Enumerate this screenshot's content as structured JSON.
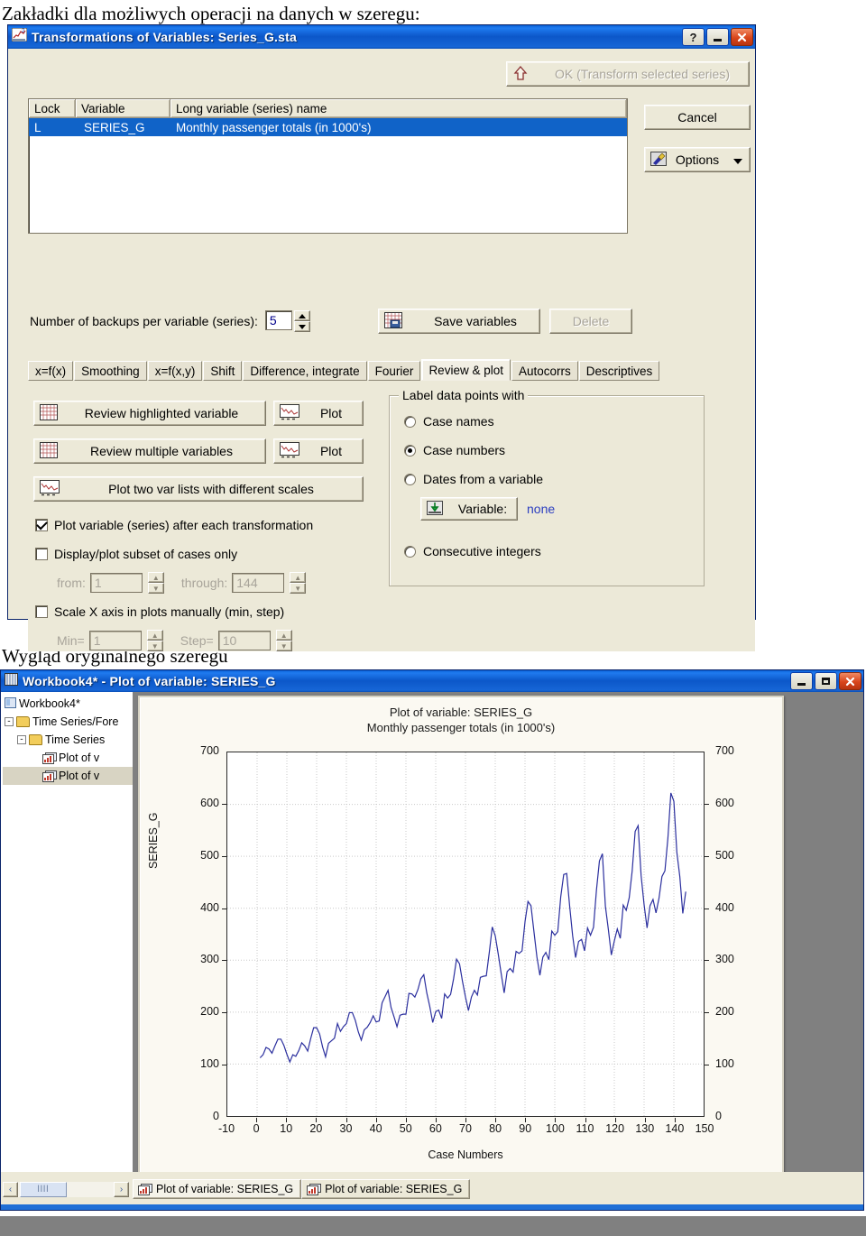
{
  "captions": {
    "top": "Zakładki dla możliwych operacji na danych w szeregu:",
    "bottom": "Wygląd oryginalnego szeregu"
  },
  "transform_dialog": {
    "title": "Transformations of Variables: Series_G.sta",
    "titlebar_buttons": {
      "help": "?",
      "minimize": "minimize-icon",
      "close": "close-icon"
    },
    "ok_button": "OK (Transform selected series)",
    "cancel_button": "Cancel",
    "options_button": "Options",
    "variable_list": {
      "headers": [
        "Lock",
        "Variable",
        "Long variable (series) name"
      ],
      "rows": [
        {
          "lock": "L",
          "variable": "SERIES_G",
          "long_name": "Monthly passenger totals (in 1000's)",
          "selected": true
        }
      ]
    },
    "backups_label": "Number of backups per variable (series):",
    "backups_value": "5",
    "save_variables_button": "Save variables",
    "delete_button": "Delete",
    "tabs": [
      {
        "label": "x=f(x)",
        "active": false
      },
      {
        "label": "Smoothing",
        "active": false
      },
      {
        "label": "x=f(x,y)",
        "active": false
      },
      {
        "label": "Shift",
        "active": false
      },
      {
        "label": "Difference, integrate",
        "active": false
      },
      {
        "label": "Fourier",
        "active": false
      },
      {
        "label": "Review & plot",
        "active": true
      },
      {
        "label": "Autocorrs",
        "active": false
      },
      {
        "label": "Descriptives",
        "active": false
      }
    ],
    "review_panel": {
      "review_highlighted_button": "Review highlighted variable",
      "plot_button_1": "Plot",
      "review_multiple_button": "Review multiple variables",
      "plot_button_2": "Plot",
      "plot_two_lists_button": "Plot two var lists with different scales",
      "checkbox_plot_variable": {
        "label": "Plot variable (series) after each transformation",
        "checked": true
      },
      "checkbox_subset": {
        "label": "Display/plot subset of cases only",
        "checked": false
      },
      "from_label": "from:",
      "from_value": "1",
      "through_label": "through:",
      "through_value": "144",
      "checkbox_scale_x": {
        "label": "Scale X axis in plots manually (min, step)",
        "checked": false
      },
      "min_label": "Min=",
      "min_value": "1",
      "step_label": "Step=",
      "step_value": "10",
      "groupbox_title": "Label data points with",
      "radios": [
        {
          "label": "Case names",
          "selected": false
        },
        {
          "label": "Case numbers",
          "selected": true
        },
        {
          "label": "Dates from a variable",
          "selected": false
        },
        {
          "label": "Consecutive integers",
          "selected": false
        }
      ],
      "variable_button": "Variable:",
      "variable_value": "none"
    }
  },
  "plot_window": {
    "title": "Workbook4* - Plot of variable: SERIES_G",
    "titlebar_buttons": {
      "minimize": "minimize-icon",
      "maximize": "maximize-icon",
      "close": "close-icon"
    },
    "tree": [
      {
        "label": "Workbook4*",
        "depth": 0,
        "expander": "",
        "icon": "workbook-icon",
        "selected": false
      },
      {
        "label": "Time Series/Fore",
        "depth": 1,
        "expander": "-",
        "icon": "folder-icon",
        "selected": false
      },
      {
        "label": "Time Series",
        "depth": 2,
        "expander": "-",
        "icon": "folder-icon",
        "selected": false
      },
      {
        "label": "Plot of v",
        "depth": 3,
        "expander": "",
        "icon": "plot-icon",
        "selected": false
      },
      {
        "label": "Plot of v",
        "depth": 3,
        "expander": "",
        "icon": "plot-icon",
        "selected": true
      }
    ],
    "document_tabs": [
      {
        "label": "Plot of variable: SERIES_G",
        "active": true
      },
      {
        "label": "Plot of variable: SERIES_G",
        "active": false
      }
    ],
    "scrollbar": {
      "left_arrow": "‹",
      "right_arrow": "›",
      "thumb": "llll"
    }
  },
  "chart_data": {
    "type": "line",
    "title": "Plot of variable: SERIES_G",
    "subtitle": "Monthly passenger totals (in 1000's)",
    "xlabel": "Case Numbers",
    "ylabel": "SERIES_G",
    "xlim": [
      -10,
      150
    ],
    "ylim": [
      0,
      700
    ],
    "xticks": [
      -10,
      0,
      10,
      20,
      30,
      40,
      50,
      60,
      70,
      80,
      90,
      100,
      110,
      120,
      130,
      140,
      150
    ],
    "yticks": [
      0,
      100,
      200,
      300,
      400,
      500,
      600,
      700
    ],
    "yticks_right": [
      0,
      100,
      200,
      300,
      400,
      500,
      600,
      700
    ],
    "grid": true,
    "legend": "none",
    "line_color": "#2b2f9e",
    "series": [
      {
        "name": "SERIES_G",
        "x_start": 1,
        "values": [
          112,
          118,
          132,
          129,
          121,
          135,
          148,
          148,
          136,
          119,
          104,
          118,
          115,
          126,
          141,
          135,
          125,
          149,
          170,
          170,
          158,
          133,
          114,
          140,
          145,
          150,
          178,
          163,
          172,
          178,
          199,
          199,
          184,
          162,
          146,
          166,
          171,
          180,
          193,
          181,
          183,
          218,
          230,
          242,
          209,
          191,
          172,
          194,
          196,
          196,
          236,
          235,
          229,
          243,
          264,
          272,
          237,
          211,
          180,
          201,
          204,
          188,
          235,
          227,
          234,
          264,
          302,
          293,
          259,
          229,
          203,
          229,
          242,
          233,
          267,
          269,
          270,
          315,
          364,
          347,
          312,
          274,
          237,
          278,
          284,
          277,
          317,
          313,
          318,
          374,
          413,
          405,
          355,
          306,
          271,
          306,
          315,
          301,
          356,
          348,
          355,
          422,
          465,
          467,
          404,
          347,
          305,
          336,
          340,
          318,
          362,
          348,
          363,
          435,
          491,
          505,
          404,
          359,
          310,
          337,
          360,
          342,
          406,
          396,
          420,
          472,
          548,
          559,
          463,
          407,
          362,
          405,
          417,
          391,
          419,
          461,
          472,
          535,
          622,
          606,
          508,
          461,
          390,
          432
        ]
      }
    ]
  }
}
